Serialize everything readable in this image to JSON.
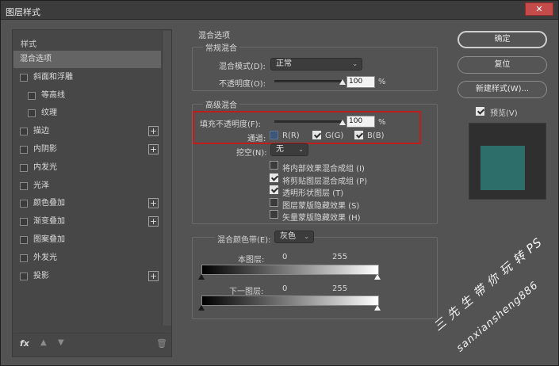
{
  "window": {
    "title": "图层样式",
    "close": "✕"
  },
  "sidebar": {
    "header": "样式",
    "items": [
      {
        "label": "混合选项",
        "checkbox": false,
        "plus": false,
        "selected": true,
        "indent": false
      },
      {
        "label": "斜面和浮雕",
        "checkbox": true,
        "plus": false,
        "selected": false,
        "indent": false
      },
      {
        "label": "等高线",
        "checkbox": true,
        "plus": false,
        "selected": false,
        "indent": true
      },
      {
        "label": "纹理",
        "checkbox": true,
        "plus": false,
        "selected": false,
        "indent": true
      },
      {
        "label": "描边",
        "checkbox": true,
        "plus": true,
        "selected": false,
        "indent": false
      },
      {
        "label": "内阴影",
        "checkbox": true,
        "plus": true,
        "selected": false,
        "indent": false
      },
      {
        "label": "内发光",
        "checkbox": true,
        "plus": false,
        "selected": false,
        "indent": false
      },
      {
        "label": "光泽",
        "checkbox": true,
        "plus": false,
        "selected": false,
        "indent": false
      },
      {
        "label": "颜色叠加",
        "checkbox": true,
        "plus": true,
        "selected": false,
        "indent": false
      },
      {
        "label": "渐变叠加",
        "checkbox": true,
        "plus": true,
        "selected": false,
        "indent": false
      },
      {
        "label": "图案叠加",
        "checkbox": true,
        "plus": false,
        "selected": false,
        "indent": false
      },
      {
        "label": "外发光",
        "checkbox": true,
        "plus": false,
        "selected": false,
        "indent": false
      },
      {
        "label": "投影",
        "checkbox": true,
        "plus": true,
        "selected": false,
        "indent": false
      }
    ],
    "plus_glyph": "+",
    "footer": {
      "fx": "fx",
      "up": "▲",
      "down": "▼",
      "trash": "🗑"
    }
  },
  "blend": {
    "title": "混合选项",
    "general": {
      "title": "常规混合",
      "mode_label": "混合模式(D):",
      "mode_value": "正常",
      "opacity_label": "不透明度(O):",
      "opacity_value": "100",
      "opacity_level": 1.0,
      "unit": "%"
    },
    "advanced": {
      "title": "高级混合",
      "fill_label": "填充不透明度(F):",
      "fill_value": "100",
      "fill_level": 1.0,
      "unit": "%",
      "channels_label": "通道:",
      "channels": [
        {
          "label": "R(R)",
          "checked": false
        },
        {
          "label": "G(G)",
          "checked": true
        },
        {
          "label": "B(B)",
          "checked": true
        }
      ],
      "knockout_label": "挖空(N):",
      "knockout_value": "无",
      "options": [
        {
          "label": "将内部效果混合成组 (I)",
          "checked": false
        },
        {
          "label": "将剪贴图层混合成组 (P)",
          "checked": true
        },
        {
          "label": "透明形状图层 (T)",
          "checked": true
        },
        {
          "label": "图层蒙版隐藏效果 (S)",
          "checked": false
        },
        {
          "label": "矢量蒙版隐藏效果 (H)",
          "checked": false
        }
      ]
    },
    "blend_if": {
      "label": "混合颜色带(E):",
      "value": "灰色",
      "this_layer_label": "本图层:",
      "this_layer_min": "0",
      "this_layer_max": "255",
      "underlying_label": "下一图层:",
      "underlying_min": "0",
      "underlying_max": "255"
    }
  },
  "buttons": {
    "ok": "确定",
    "reset": "复位",
    "new_style": "新建样式(W)...",
    "preview_label": "预览(V)",
    "preview_checked": true
  },
  "preview": {
    "swatch_color": "#2e6e6a"
  },
  "watermark": {
    "line1": "三 先 生 带 你 玩 转 PS",
    "line2": "sanxiansheng886"
  },
  "colors": {
    "highlight_box": "#c01d1d",
    "panel": "#535353"
  }
}
